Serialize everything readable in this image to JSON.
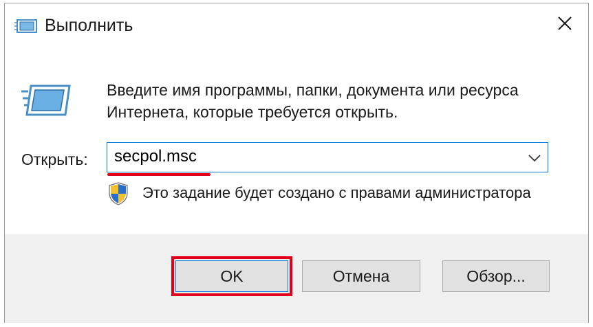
{
  "window": {
    "title": "Выполнить",
    "title_icon": "run-dialog-icon",
    "close_icon": "close-icon"
  },
  "content": {
    "description_line1": "Введите имя программы, папки, документа или ресурса",
    "description_line2": "Интернета, которые требуется открыть.",
    "open_label": "Открыть:",
    "open_value": "secpol.msc",
    "admin_note": "Это задание будет создано с правами администратора"
  },
  "buttons": {
    "ok": "OK",
    "cancel": "Отмена",
    "browse": "Обзор..."
  },
  "colors": {
    "accent": "#0078d7",
    "highlight": "#e2001a",
    "footer_bg": "#f0f0f0"
  }
}
